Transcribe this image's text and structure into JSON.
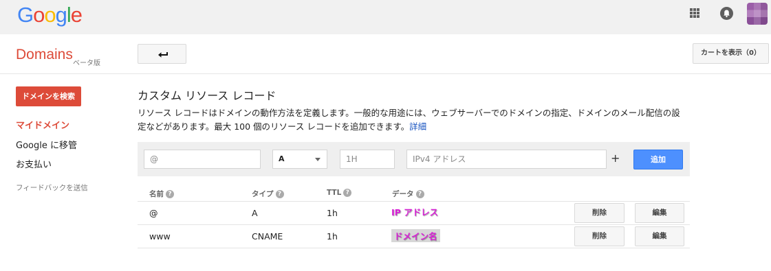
{
  "topbar": {
    "logo_letters": [
      {
        "ch": "G",
        "color": "#4285f4"
      },
      {
        "ch": "o",
        "color": "#ea4335"
      },
      {
        "ch": "o",
        "color": "#fbbc05"
      },
      {
        "ch": "g",
        "color": "#4285f4"
      },
      {
        "ch": "l",
        "color": "#34a853"
      },
      {
        "ch": "e",
        "color": "#ea4335"
      }
    ],
    "icons": [
      "apps-grid-icon",
      "notification-bell-icon",
      "account-avatar"
    ]
  },
  "header": {
    "title": "Domains",
    "beta": "ベータ版",
    "back_icon": "back-arrow-icon",
    "cart_label": "カートを表示（0）"
  },
  "sidebar": {
    "search_button": "ドメインを検索",
    "items": [
      {
        "label": "マイドメイン",
        "active": true
      },
      {
        "label": "Google に移管",
        "active": false
      },
      {
        "label": "お支払い",
        "active": false
      }
    ],
    "feedback": "フィードバックを送信"
  },
  "main": {
    "title": "カスタム リソース レコード",
    "description": "リソース レコードはドメインの動作方法を定義します。一般的な用途には、ウェブサーバーでのドメインの指定、ドメインのメール配信の設定などがあります。最大 100 個のリソース レコードを追加できます。",
    "details_link": "詳細",
    "form": {
      "name_placeholder": "@",
      "type_value": "A",
      "ttl_placeholder": "1H",
      "data_placeholder": "IPv4 アドレス",
      "plus": "+",
      "add_label": "追加"
    },
    "columns": [
      "名前",
      "タイプ",
      "TTL",
      "データ"
    ],
    "rows": [
      {
        "name": "@",
        "type": "A",
        "ttl": "1h",
        "data": "IP アドレス",
        "delete": "削除",
        "edit": "編集"
      },
      {
        "name": "www",
        "type": "CNAME",
        "ttl": "1h",
        "data": "ドメイン名",
        "delete": "削除",
        "edit": "編集"
      }
    ]
  },
  "colors": {
    "brand_red": "#dd4b39",
    "primary_blue": "#4d90fe",
    "link_blue": "#1a55c0",
    "annotation_magenta": "#d81ed6"
  }
}
